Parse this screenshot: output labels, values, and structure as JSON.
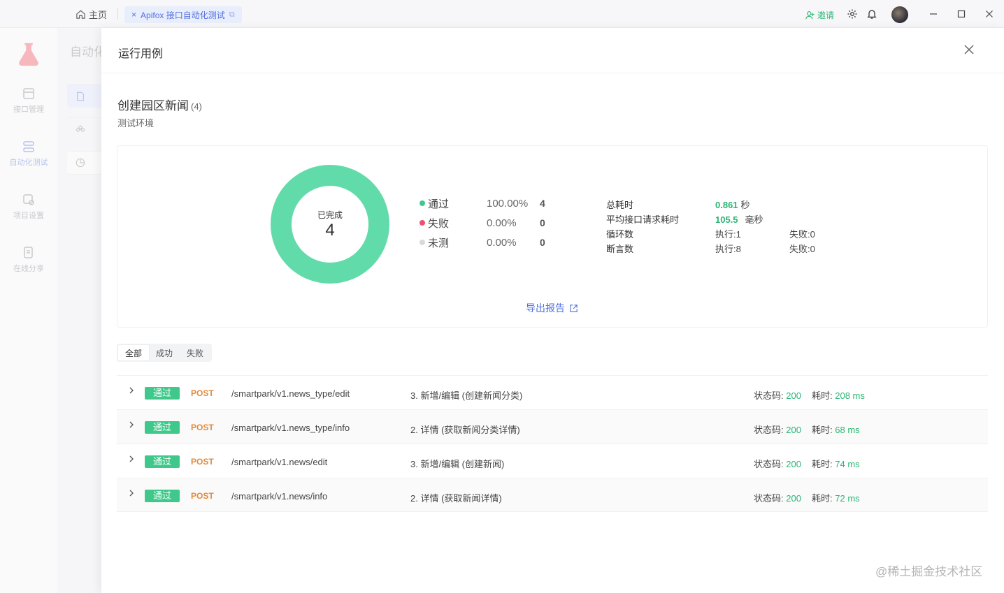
{
  "titlebar": {
    "home_label": "主页",
    "tab_label": "Apifox 接口自动化测试",
    "invite_label": "邀请"
  },
  "leftnav": {
    "items": [
      {
        "label": "接口管理",
        "icon": "api-icon"
      },
      {
        "label": "自动化测试",
        "icon": "automation-icon"
      },
      {
        "label": "项目设置",
        "icon": "settings-icon"
      },
      {
        "label": "在线分享",
        "icon": "share-icon"
      }
    ],
    "subnav_title": "自动化测试"
  },
  "drawer": {
    "title": "运行用例",
    "case_name": "创建园区新闻",
    "case_count": "(4)",
    "environment": "测试环境"
  },
  "summary": {
    "donut_label": "已完成",
    "donut_value": "4",
    "pass_fraction": 1.0,
    "legend": [
      {
        "label": "通过",
        "pct": "100.00%",
        "count": "4",
        "color": "#3ec98a"
      },
      {
        "label": "失败",
        "pct": "0.00%",
        "count": "0",
        "color": "#f0506e"
      },
      {
        "label": "未测",
        "pct": "0.00%",
        "count": "0",
        "color": "#d9d9d9"
      }
    ],
    "stats": {
      "total_time_label": "总耗时",
      "total_time_value": "0.861",
      "total_time_unit": "秒",
      "avg_label": "平均接口请求耗时",
      "avg_value": "105.5",
      "avg_unit": "毫秒",
      "loop_label": "循环数",
      "loop_exec": "执行:1",
      "loop_fail": "失败:0",
      "assert_label": "断言数",
      "assert_exec": "执行:8",
      "assert_fail": "失败:0"
    },
    "export_label": "导出报告"
  },
  "filter_tabs": [
    "全部",
    "成功",
    "失败"
  ],
  "results": [
    {
      "badge": "通过",
      "method": "POST",
      "path": "/smartpark/v1.news_type/edit",
      "desc": "3. 新增/编辑 (创建新闻分类)",
      "status_label": "状态码:",
      "status": "200",
      "time_label": "耗时:",
      "time": "208 ms"
    },
    {
      "badge": "通过",
      "method": "POST",
      "path": "/smartpark/v1.news_type/info",
      "desc": "2. 详情 (获取新闻分类详情)",
      "status_label": "状态码:",
      "status": "200",
      "time_label": "耗时:",
      "time": "68 ms"
    },
    {
      "badge": "通过",
      "method": "POST",
      "path": "/smartpark/v1.news/edit",
      "desc": "3. 新增/编辑 (创建新闻)",
      "status_label": "状态码:",
      "status": "200",
      "time_label": "耗时:",
      "time": "74 ms"
    },
    {
      "badge": "通过",
      "method": "POST",
      "path": "/smartpark/v1.news/info",
      "desc": "2. 详情 (获取新闻详情)",
      "status_label": "状态码:",
      "status": "200",
      "time_label": "耗时:",
      "time": "72 ms"
    }
  ],
  "watermark": "@稀土掘金技术社区"
}
